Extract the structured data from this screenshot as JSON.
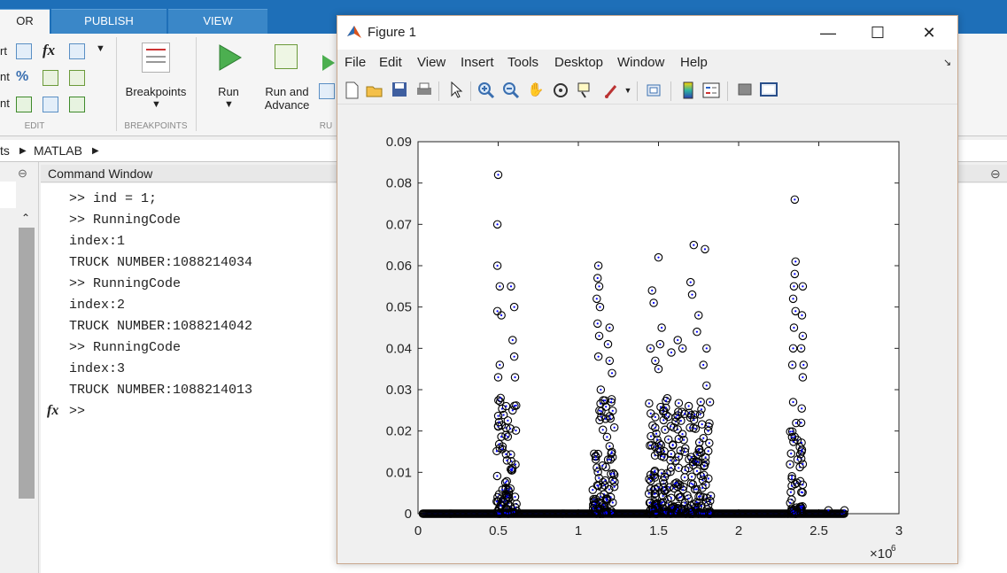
{
  "matlab": {
    "tabs": [
      "OR",
      "PUBLISH",
      "VIEW"
    ],
    "edit_section": {
      "row_labels": [
        "rt",
        "nt",
        "nt"
      ],
      "section_label": "EDIT"
    },
    "breakpoints": {
      "label": "Breakpoints",
      "section_label": "BREAKPOINTS"
    },
    "run": {
      "label": "Run",
      "run_advance_line1": "Run and",
      "run_advance_line2": "Advance",
      "section_label": "RU"
    },
    "address": {
      "prefix": "ts",
      "folder": "MATLAB"
    },
    "command_window": {
      "title": "Command Window",
      "lines": [
        ">> ind = 1;",
        ">> RunningCode",
        "index:1",
        "TRUCK NUMBER:1088214034",
        ">> RunningCode",
        "index:2",
        "TRUCK NUMBER:1088214042",
        ">> RunningCode",
        "index:3",
        "TRUCK NUMBER:1088214013"
      ],
      "prompt_fx": "fx",
      "prompt": ">>"
    }
  },
  "figure": {
    "title": "Figure 1",
    "menu": [
      "File",
      "Edit",
      "View",
      "Insert",
      "Tools",
      "Desktop",
      "Window",
      "Help"
    ],
    "toolbar_icons": [
      "new-figure-icon",
      "open-file-icon",
      "save-icon",
      "print-icon",
      "pointer-icon",
      "zoom-in-icon",
      "zoom-out-icon",
      "pan-icon",
      "rotate-icon",
      "data-cursor-icon",
      "brush-icon",
      "link-plot-icon",
      "colorbar-icon",
      "legend-icon",
      "hide-plot-tools-icon",
      "show-plot-tools-icon"
    ]
  },
  "chart_data": {
    "type": "scatter",
    "xlim": [
      0,
      3000000
    ],
    "ylim": [
      0,
      0.09
    ],
    "x_ticks": [
      "0",
      "0.5",
      "1",
      "1.5",
      "2",
      "2.5",
      "3"
    ],
    "y_ticks": [
      "0",
      "0.01",
      "0.02",
      "0.03",
      "0.04",
      "0.05",
      "0.06",
      "0.07",
      "0.08",
      "0.09"
    ],
    "x_exponent_label": "×10",
    "x_exponent_power": "6",
    "marker_outer_color": "#000000",
    "marker_inner_color": "#0000ff",
    "baseline_range": [
      30000,
      2660000
    ],
    "clusters": [
      {
        "x_range": [
          490000,
          620000
        ],
        "peaks": [
          [
            500000,
            0.082
          ],
          [
            495000,
            0.07
          ],
          [
            495000,
            0.06
          ],
          [
            510000,
            0.055
          ],
          [
            580000,
            0.055
          ],
          [
            600000,
            0.05
          ],
          [
            495000,
            0.049
          ],
          [
            520000,
            0.048
          ],
          [
            590000,
            0.042
          ],
          [
            600000,
            0.038
          ],
          [
            510000,
            0.036
          ],
          [
            500000,
            0.033
          ],
          [
            605000,
            0.033
          ],
          [
            515000,
            0.028
          ],
          [
            590000,
            0.025
          ]
        ]
      },
      {
        "x_range": [
          1090000,
          1230000
        ],
        "peaks": [
          [
            1125000,
            0.06
          ],
          [
            1120000,
            0.057
          ],
          [
            1130000,
            0.055
          ],
          [
            1115000,
            0.052
          ],
          [
            1135000,
            0.05
          ],
          [
            1120000,
            0.046
          ],
          [
            1195000,
            0.045
          ],
          [
            1130000,
            0.043
          ],
          [
            1185000,
            0.041
          ],
          [
            1125000,
            0.038
          ],
          [
            1195000,
            0.037
          ],
          [
            1210000,
            0.034
          ],
          [
            1140000,
            0.03
          ],
          [
            1205000,
            0.027
          ]
        ]
      },
      {
        "x_range": [
          1440000,
          1830000
        ],
        "peaks": [
          [
            1460000,
            0.054
          ],
          [
            1470000,
            0.051
          ],
          [
            1500000,
            0.062
          ],
          [
            1520000,
            0.045
          ],
          [
            1510000,
            0.041
          ],
          [
            1450000,
            0.04
          ],
          [
            1480000,
            0.037
          ],
          [
            1500000,
            0.035
          ],
          [
            1580000,
            0.039
          ],
          [
            1620000,
            0.042
          ],
          [
            1650000,
            0.04
          ],
          [
            1700000,
            0.056
          ],
          [
            1710000,
            0.053
          ],
          [
            1720000,
            0.065
          ],
          [
            1790000,
            0.064
          ],
          [
            1750000,
            0.048
          ],
          [
            1740000,
            0.044
          ],
          [
            1800000,
            0.04
          ],
          [
            1780000,
            0.036
          ],
          [
            1800000,
            0.031
          ],
          [
            1810000,
            0.02
          ],
          [
            1760000,
            0.024
          ]
        ]
      },
      {
        "x_range": [
          2320000,
          2400000
        ],
        "peaks": [
          [
            2350000,
            0.076
          ],
          [
            2355000,
            0.061
          ],
          [
            2350000,
            0.058
          ],
          [
            2345000,
            0.055
          ],
          [
            2400000,
            0.055
          ],
          [
            2340000,
            0.052
          ],
          [
            2355000,
            0.049
          ],
          [
            2395000,
            0.048
          ],
          [
            2345000,
            0.045
          ],
          [
            2400000,
            0.043
          ],
          [
            2340000,
            0.04
          ],
          [
            2390000,
            0.04
          ],
          [
            2405000,
            0.036
          ],
          [
            2335000,
            0.036
          ],
          [
            2400000,
            0.033
          ],
          [
            2340000,
            0.027
          ],
          [
            2390000,
            0.022
          ],
          [
            2400000,
            0.012
          ],
          [
            2400000,
            0.007
          ]
        ]
      }
    ]
  }
}
